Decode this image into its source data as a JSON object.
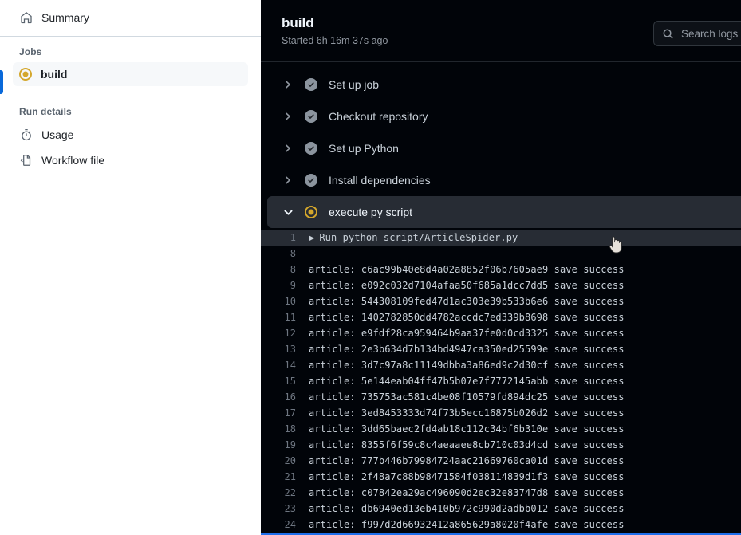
{
  "sidebar": {
    "summary": {
      "label": "Summary",
      "icon": "home-icon"
    },
    "jobs_label": "Jobs",
    "jobs": [
      {
        "label": "build",
        "status_icon": "spinner-in-progress-icon",
        "active": true
      }
    ],
    "run_details_label": "Run details",
    "run_details": [
      {
        "label": "Usage",
        "icon": "stopwatch-icon"
      },
      {
        "label": "Workflow file",
        "icon": "file-code-icon"
      }
    ]
  },
  "header": {
    "title": "build",
    "subtitle": "Started 6h 16m 37s ago",
    "search": {
      "placeholder": "Search logs",
      "visible_text": "Sear",
      "icon": "search-icon"
    }
  },
  "steps": [
    {
      "label": "Set up job",
      "status": "success",
      "expanded": false,
      "chevron": "chevron-right-icon"
    },
    {
      "label": "Checkout repository",
      "status": "success",
      "expanded": false,
      "chevron": "chevron-right-icon"
    },
    {
      "label": "Set up Python",
      "status": "success",
      "expanded": false,
      "chevron": "chevron-right-icon"
    },
    {
      "label": "Install dependencies",
      "status": "success",
      "expanded": false,
      "chevron": "chevron-right-icon"
    },
    {
      "label": "execute py script",
      "status": "in_progress",
      "expanded": true,
      "chevron": "chevron-down-icon"
    }
  ],
  "log": {
    "lines": [
      {
        "num": "1",
        "text": "Run python script/ArticleSpider.py",
        "group": true,
        "highlighted": true
      },
      {
        "num": "8",
        "text": "",
        "highlighted": false
      },
      {
        "num": "8",
        "text": "article: c6ac99b40e8d4a02a8852f06b7605ae9 save success",
        "highlighted": false
      },
      {
        "num": "9",
        "text": "article: e092c032d7104afaa50f685a1dcc7dd5 save success",
        "highlighted": false
      },
      {
        "num": "10",
        "text": "article: 544308109fed47d1ac303e39b533b6e6 save success",
        "highlighted": false
      },
      {
        "num": "11",
        "text": "article: 1402782850dd4782accdc7ed339b8698 save success",
        "highlighted": false
      },
      {
        "num": "12",
        "text": "article: e9fdf28ca959464b9aa37fe0d0cd3325 save success",
        "highlighted": false
      },
      {
        "num": "13",
        "text": "article: 2e3b634d7b134bd4947ca350ed25599e save success",
        "highlighted": false
      },
      {
        "num": "14",
        "text": "article: 3d7c97a8c11149dbba3a86ed9c2d30cf save success",
        "highlighted": false
      },
      {
        "num": "15",
        "text": "article: 5e144eab04ff47b5b07e7f7772145abb save success",
        "highlighted": false
      },
      {
        "num": "16",
        "text": "article: 735753ac581c4be08f10579fd894dc25 save success",
        "highlighted": false
      },
      {
        "num": "17",
        "text": "article: 3ed8453333d74f73b5ecc16875b026d2 save success",
        "highlighted": false
      },
      {
        "num": "18",
        "text": "article: 3dd65baec2fd4ab18c112c34bf6b310e save success",
        "highlighted": false
      },
      {
        "num": "19",
        "text": "article: 8355f6f59c8c4aeaaee8cb710c03d4cd save success",
        "highlighted": false
      },
      {
        "num": "20",
        "text": "article: 777b446b79984724aac21669760ca01d save success",
        "highlighted": false
      },
      {
        "num": "21",
        "text": "article: 2f48a7c88b98471584f038114839d1f3 save success",
        "highlighted": false
      },
      {
        "num": "22",
        "text": "article: c07842ea29ac496090d2ec32e83747d8 save success",
        "highlighted": false
      },
      {
        "num": "23",
        "text": "article: db6940ed13eb410b972c990d2adbb012 save success",
        "highlighted": false
      },
      {
        "num": "24",
        "text": "article: f997d2d66932412a865629a8020f4afe save success",
        "highlighted": false
      }
    ]
  },
  "colors": {
    "accent_blue": "#0969da",
    "panel_bg": "#010409",
    "in_progress_yellow": "#d4a72c",
    "success_gray": "#8b949e",
    "bottom_bar_blue": "#1f6feb"
  }
}
